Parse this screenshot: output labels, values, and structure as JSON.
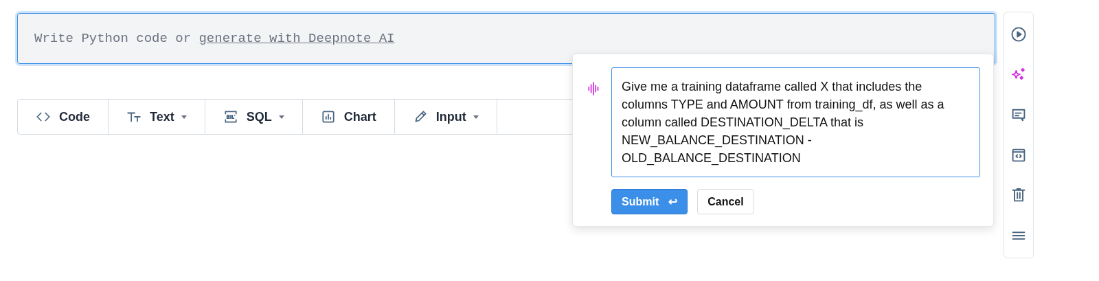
{
  "code_cell": {
    "placeholder": "Write Python code or ",
    "link": "generate with Deepnote AI"
  },
  "block_toolbar": [
    {
      "kind": "code",
      "label": "Code",
      "dropdown": false
    },
    {
      "kind": "text",
      "label": "Text",
      "dropdown": true
    },
    {
      "kind": "sql",
      "label": "SQL",
      "dropdown": true
    },
    {
      "kind": "chart",
      "label": "Chart",
      "dropdown": false
    },
    {
      "kind": "input",
      "label": "Input",
      "dropdown": true
    }
  ],
  "ai_prompt": {
    "value": "Give me a training dataframe called X that includes the columns TYPE and AMOUNT from training_df, as well as a column called DESTINATION_DELTA that is NEW_BALANCE_DESTINATION - OLD_BALANCE_DESTINATION",
    "submit": "Submit",
    "submit_key": "↩",
    "cancel": "Cancel"
  },
  "side_actions": [
    {
      "kind": "run"
    },
    {
      "kind": "ai"
    },
    {
      "kind": "comment"
    },
    {
      "kind": "embed"
    },
    {
      "kind": "delete"
    },
    {
      "kind": "menu"
    }
  ]
}
